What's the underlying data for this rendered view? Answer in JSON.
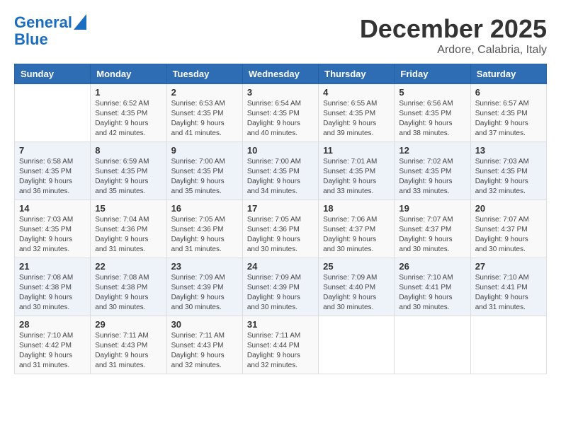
{
  "logo": {
    "line1": "General",
    "line2": "Blue"
  },
  "header": {
    "month": "December 2025",
    "location": "Ardore, Calabria, Italy"
  },
  "days_of_week": [
    "Sunday",
    "Monday",
    "Tuesday",
    "Wednesday",
    "Thursday",
    "Friday",
    "Saturday"
  ],
  "weeks": [
    [
      {
        "day": "",
        "sunrise": "",
        "sunset": "",
        "daylight": "",
        "empty": true
      },
      {
        "day": "1",
        "sunrise": "Sunrise: 6:52 AM",
        "sunset": "Sunset: 4:35 PM",
        "daylight": "Daylight: 9 hours and 42 minutes."
      },
      {
        "day": "2",
        "sunrise": "Sunrise: 6:53 AM",
        "sunset": "Sunset: 4:35 PM",
        "daylight": "Daylight: 9 hours and 41 minutes."
      },
      {
        "day": "3",
        "sunrise": "Sunrise: 6:54 AM",
        "sunset": "Sunset: 4:35 PM",
        "daylight": "Daylight: 9 hours and 40 minutes."
      },
      {
        "day": "4",
        "sunrise": "Sunrise: 6:55 AM",
        "sunset": "Sunset: 4:35 PM",
        "daylight": "Daylight: 9 hours and 39 minutes."
      },
      {
        "day": "5",
        "sunrise": "Sunrise: 6:56 AM",
        "sunset": "Sunset: 4:35 PM",
        "daylight": "Daylight: 9 hours and 38 minutes."
      },
      {
        "day": "6",
        "sunrise": "Sunrise: 6:57 AM",
        "sunset": "Sunset: 4:35 PM",
        "daylight": "Daylight: 9 hours and 37 minutes."
      }
    ],
    [
      {
        "day": "7",
        "sunrise": "Sunrise: 6:58 AM",
        "sunset": "Sunset: 4:35 PM",
        "daylight": "Daylight: 9 hours and 36 minutes."
      },
      {
        "day": "8",
        "sunrise": "Sunrise: 6:59 AM",
        "sunset": "Sunset: 4:35 PM",
        "daylight": "Daylight: 9 hours and 35 minutes."
      },
      {
        "day": "9",
        "sunrise": "Sunrise: 7:00 AM",
        "sunset": "Sunset: 4:35 PM",
        "daylight": "Daylight: 9 hours and 35 minutes."
      },
      {
        "day": "10",
        "sunrise": "Sunrise: 7:00 AM",
        "sunset": "Sunset: 4:35 PM",
        "daylight": "Daylight: 9 hours and 34 minutes."
      },
      {
        "day": "11",
        "sunrise": "Sunrise: 7:01 AM",
        "sunset": "Sunset: 4:35 PM",
        "daylight": "Daylight: 9 hours and 33 minutes."
      },
      {
        "day": "12",
        "sunrise": "Sunrise: 7:02 AM",
        "sunset": "Sunset: 4:35 PM",
        "daylight": "Daylight: 9 hours and 33 minutes."
      },
      {
        "day": "13",
        "sunrise": "Sunrise: 7:03 AM",
        "sunset": "Sunset: 4:35 PM",
        "daylight": "Daylight: 9 hours and 32 minutes."
      }
    ],
    [
      {
        "day": "14",
        "sunrise": "Sunrise: 7:03 AM",
        "sunset": "Sunset: 4:35 PM",
        "daylight": "Daylight: 9 hours and 32 minutes."
      },
      {
        "day": "15",
        "sunrise": "Sunrise: 7:04 AM",
        "sunset": "Sunset: 4:36 PM",
        "daylight": "Daylight: 9 hours and 31 minutes."
      },
      {
        "day": "16",
        "sunrise": "Sunrise: 7:05 AM",
        "sunset": "Sunset: 4:36 PM",
        "daylight": "Daylight: 9 hours and 31 minutes."
      },
      {
        "day": "17",
        "sunrise": "Sunrise: 7:05 AM",
        "sunset": "Sunset: 4:36 PM",
        "daylight": "Daylight: 9 hours and 30 minutes."
      },
      {
        "day": "18",
        "sunrise": "Sunrise: 7:06 AM",
        "sunset": "Sunset: 4:37 PM",
        "daylight": "Daylight: 9 hours and 30 minutes."
      },
      {
        "day": "19",
        "sunrise": "Sunrise: 7:07 AM",
        "sunset": "Sunset: 4:37 PM",
        "daylight": "Daylight: 9 hours and 30 minutes."
      },
      {
        "day": "20",
        "sunrise": "Sunrise: 7:07 AM",
        "sunset": "Sunset: 4:37 PM",
        "daylight": "Daylight: 9 hours and 30 minutes."
      }
    ],
    [
      {
        "day": "21",
        "sunrise": "Sunrise: 7:08 AM",
        "sunset": "Sunset: 4:38 PM",
        "daylight": "Daylight: 9 hours and 30 minutes."
      },
      {
        "day": "22",
        "sunrise": "Sunrise: 7:08 AM",
        "sunset": "Sunset: 4:38 PM",
        "daylight": "Daylight: 9 hours and 30 minutes."
      },
      {
        "day": "23",
        "sunrise": "Sunrise: 7:09 AM",
        "sunset": "Sunset: 4:39 PM",
        "daylight": "Daylight: 9 hours and 30 minutes."
      },
      {
        "day": "24",
        "sunrise": "Sunrise: 7:09 AM",
        "sunset": "Sunset: 4:39 PM",
        "daylight": "Daylight: 9 hours and 30 minutes."
      },
      {
        "day": "25",
        "sunrise": "Sunrise: 7:09 AM",
        "sunset": "Sunset: 4:40 PM",
        "daylight": "Daylight: 9 hours and 30 minutes."
      },
      {
        "day": "26",
        "sunrise": "Sunrise: 7:10 AM",
        "sunset": "Sunset: 4:41 PM",
        "daylight": "Daylight: 9 hours and 30 minutes."
      },
      {
        "day": "27",
        "sunrise": "Sunrise: 7:10 AM",
        "sunset": "Sunset: 4:41 PM",
        "daylight": "Daylight: 9 hours and 31 minutes."
      }
    ],
    [
      {
        "day": "28",
        "sunrise": "Sunrise: 7:10 AM",
        "sunset": "Sunset: 4:42 PM",
        "daylight": "Daylight: 9 hours and 31 minutes."
      },
      {
        "day": "29",
        "sunrise": "Sunrise: 7:11 AM",
        "sunset": "Sunset: 4:43 PM",
        "daylight": "Daylight: 9 hours and 31 minutes."
      },
      {
        "day": "30",
        "sunrise": "Sunrise: 7:11 AM",
        "sunset": "Sunset: 4:43 PM",
        "daylight": "Daylight: 9 hours and 32 minutes."
      },
      {
        "day": "31",
        "sunrise": "Sunrise: 7:11 AM",
        "sunset": "Sunset: 4:44 PM",
        "daylight": "Daylight: 9 hours and 32 minutes."
      },
      {
        "day": "",
        "sunrise": "",
        "sunset": "",
        "daylight": "",
        "empty": true
      },
      {
        "day": "",
        "sunrise": "",
        "sunset": "",
        "daylight": "",
        "empty": true
      },
      {
        "day": "",
        "sunrise": "",
        "sunset": "",
        "daylight": "",
        "empty": true
      }
    ]
  ]
}
